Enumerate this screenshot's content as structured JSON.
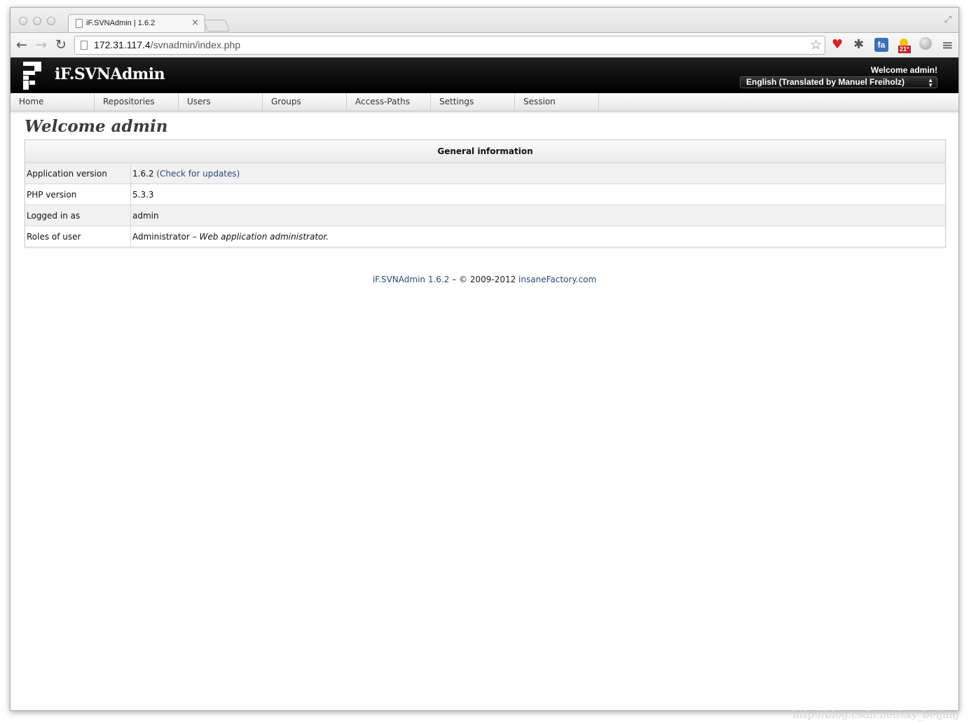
{
  "browser": {
    "tab_title": "iF.SVNAdmin | 1.6.2",
    "tab_close": "×",
    "url_host": "172.31.117.4",
    "url_path": "/svnadmin/index.php",
    "extensions": [
      "heart-icon",
      "bug-icon",
      "fa-icon",
      "weather-icon",
      "globe-icon"
    ],
    "weather_badge": "21°",
    "menu_icon": "≡"
  },
  "app": {
    "title": "iF.SVNAdmin",
    "welcome": "Welcome admin!",
    "language": "English (Translated by Manuel Freiholz)"
  },
  "menu": {
    "items": [
      "Home",
      "Repositories",
      "Users",
      "Groups",
      "Access-Paths",
      "Settings",
      "Session"
    ]
  },
  "page": {
    "title": "Welcome admin"
  },
  "info": {
    "header": "General information",
    "rows": [
      {
        "key": "Application version",
        "value": "1.6.2",
        "link": "(Check for updates)"
      },
      {
        "key": "PHP version",
        "value": "5.3.3"
      },
      {
        "key": "Logged in as",
        "value": "admin"
      },
      {
        "key": "Roles of user",
        "value": "Administrator –",
        "desc": "Web application administrator."
      }
    ]
  },
  "footer": {
    "product": "iF.SVNAdmin 1.6.2",
    "copyright": " – © 2009-2012 ",
    "site": "insaneFactory.com"
  },
  "watermark": "http://blog.csdn.net/sxy_beijing",
  "colors": {
    "header_bg": "#000000",
    "link": "#2a4a7a",
    "heart": "#d8222a"
  }
}
